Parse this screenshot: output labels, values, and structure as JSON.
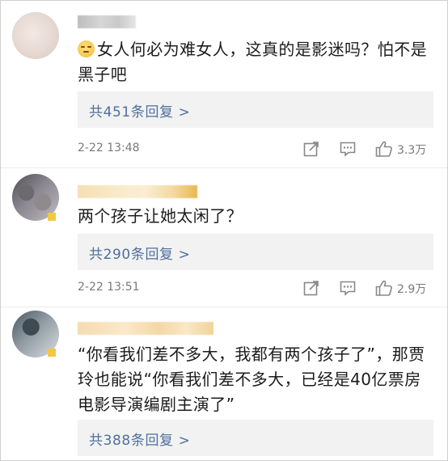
{
  "comments": [
    {
      "text": "女人何必为难女人，这真的是影迷吗？怕不是黑子吧",
      "line1": "女人何必为难女人，这真的是影迷吗？怕不是",
      "line2": "黑子吧",
      "has_emoji": true,
      "replies_label": "共451条回复 >",
      "time": "2-22 13:48",
      "likes": "3.3万"
    },
    {
      "text": "两个孩子让她太闲了？",
      "line1": "两个孩子让她太闲了？",
      "replies_label": "共290条回复 >",
      "time": "2-22 13:51",
      "likes": "2.9万"
    },
    {
      "text": "“你看我们差不多大，我都有两个孩子了”，那贾玲也能说“你看我们差不多大，已经是40亿票房电影导演编剧主演了”",
      "line1": "“你看我们差不多大，我都有两个孩子了”，那贾",
      "line2": "玲也能说“你看我们差不多大，已经是40亿票房",
      "line3": "电影导演编剧主演了”",
      "replies_label": "共388条回复 >"
    }
  ],
  "icons": {
    "share": "share-icon",
    "comment": "comment-icon",
    "like": "thumbs-up-icon"
  },
  "colors": {
    "reply_link": "#4e6f9e",
    "reply_bg": "#f2f2f2",
    "meta_gray": "#7a7a7a"
  }
}
